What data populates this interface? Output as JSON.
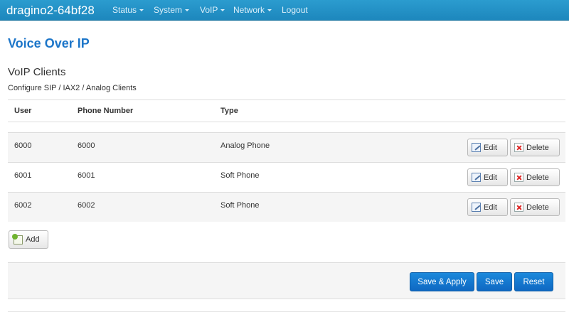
{
  "navbar": {
    "brand": "dragino2-64bf28",
    "menu": [
      {
        "label": "Status",
        "dropdown": true
      },
      {
        "label": "System",
        "dropdown": true
      },
      {
        "label": "VoIP",
        "dropdown": true
      },
      {
        "label": "Network",
        "dropdown": true
      },
      {
        "label": "Logout",
        "dropdown": false
      }
    ]
  },
  "page": {
    "title": "Voice Over IP",
    "section_title": "VoIP Clients",
    "section_description": "Configure SIP / IAX2 / Analog Clients"
  },
  "table": {
    "columns": [
      "User",
      "Phone Number",
      "Type"
    ],
    "rows": [
      {
        "user": "6000",
        "phone": "6000",
        "type": "Analog Phone"
      },
      {
        "user": "6001",
        "phone": "6001",
        "type": "Soft Phone"
      },
      {
        "user": "6002",
        "phone": "6002",
        "type": "Soft Phone"
      }
    ],
    "edit_label": "Edit",
    "delete_label": "Delete"
  },
  "add_label": "Add",
  "actions": {
    "save_apply": "Save & Apply",
    "save": "Save",
    "reset": "Reset"
  },
  "colors": {
    "navbar": "#1d87bd",
    "title": "#1d76c9",
    "primary_button": "#1577cf"
  }
}
